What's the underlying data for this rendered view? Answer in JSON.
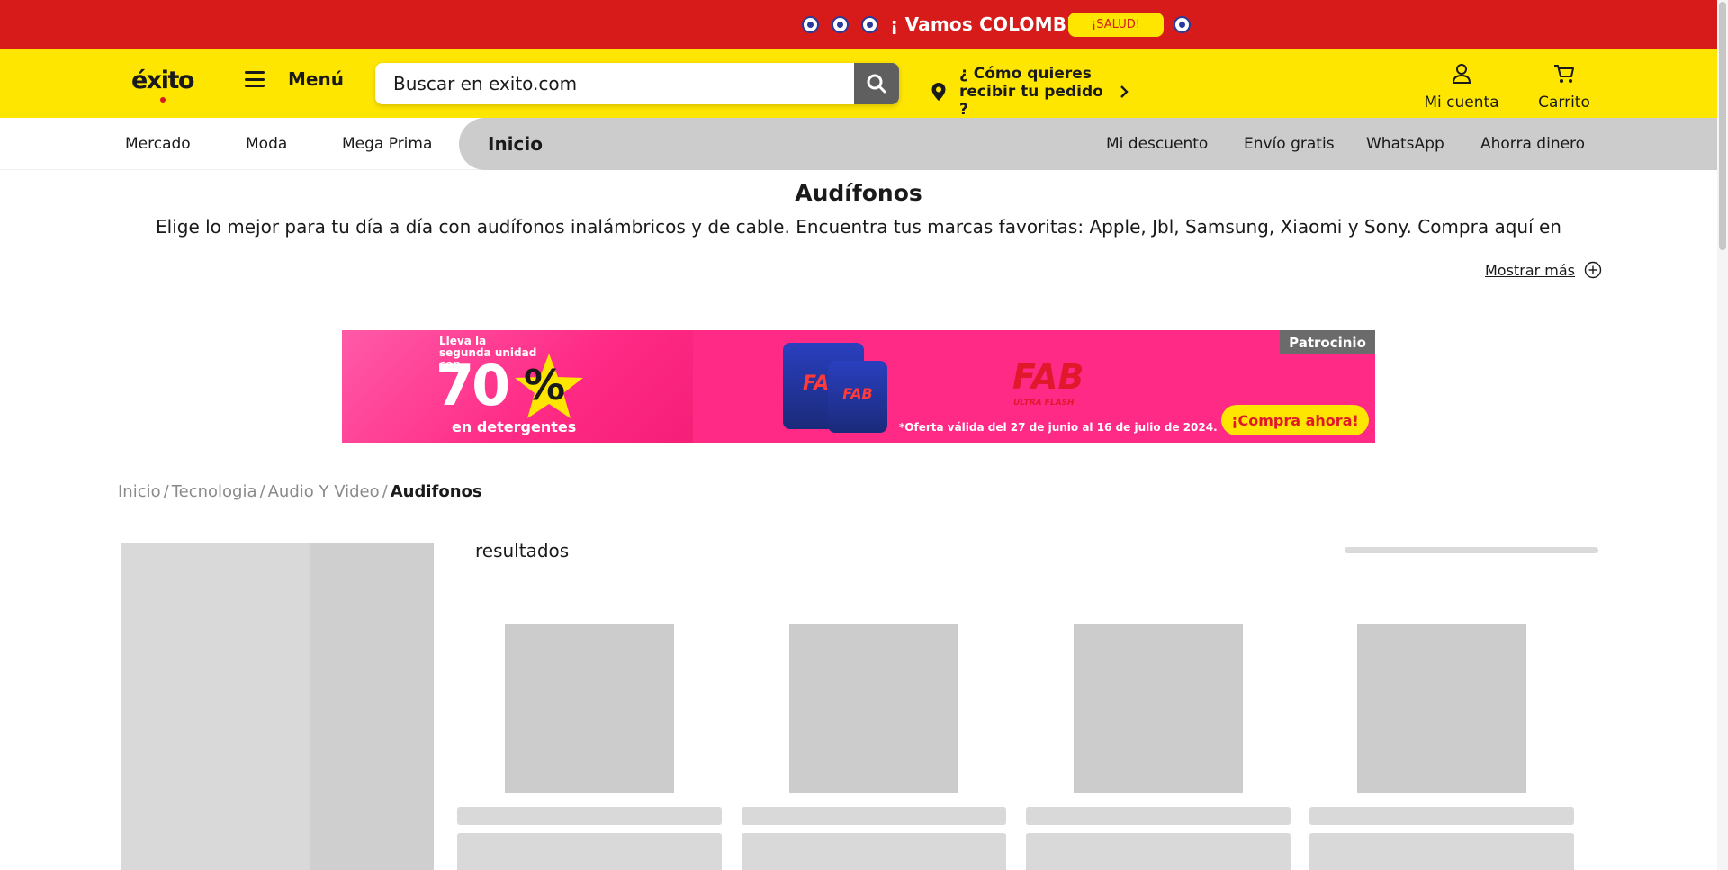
{
  "promo_bar": {
    "message": "¡ Vamos COLOMBIA !",
    "button_label": "¡SALUD!",
    "colors": {
      "background": "#d71a1a",
      "button": "#ffe600"
    },
    "icon": "soccer-ball-icon"
  },
  "header": {
    "logo_text": "éxito",
    "menu_label": "Menú",
    "search": {
      "placeholder": "Buscar en exito.com",
      "value": ""
    },
    "delivery_text": "¿ Cómo quieres recibir tu pedido ?",
    "account_label": "Mi cuenta",
    "cart_label": "Carrito",
    "colors": {
      "background": "#ffe600",
      "search_button": "#5f5f5f"
    }
  },
  "nav": {
    "left_items": [
      "Mercado",
      "Moda",
      "Mega Prima"
    ],
    "active_label": "Inicio",
    "right_items": [
      "Mi descuento",
      "Envío gratis",
      "WhatsApp",
      "Ahorra dinero"
    ]
  },
  "category": {
    "title": "Audífonos",
    "description": "Elige lo mejor para tu día a día con audífonos inalámbricos y de cable. Encuentra tus marcas favoritas: Apple, Jbl, Samsung, Xiaomi y Sony. Compra aquí en",
    "show_more_label": "Mostrar más"
  },
  "ad_banner": {
    "promo_small": "Lleva la segunda unidad con",
    "promo_big": "70",
    "promo_percent": "%",
    "promo_sub": "en detergentes",
    "pack_label": "FAB",
    "brand": "FAB",
    "brand_sub": "ULTRA FLASH",
    "offer_text": "*Oferta válida del 27 de junio al 16 de julio de 2024.",
    "cta_label": "¡Compra ahora!",
    "sponsor_label": "Patrocinio",
    "colors": {
      "background": "#ff2a85",
      "cta": "#ffe600",
      "brand": "#e0182c"
    }
  },
  "breadcrumb": {
    "items": [
      "Inicio",
      "Tecnologia",
      "Audio Y Video"
    ],
    "current": "Audifonos"
  },
  "results": {
    "label": "resultados"
  }
}
